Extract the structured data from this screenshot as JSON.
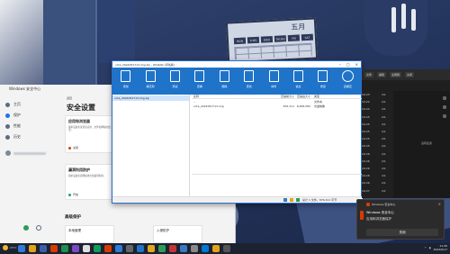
{
  "wallpaper": {
    "calendar_month": "五月",
    "calendar_days": [
      "MON",
      "TUES",
      "WED",
      "THURS",
      "FRI",
      "SAT"
    ]
  },
  "security_app": {
    "app_title": "Windows 安全中心",
    "nav": [
      {
        "label": "主页",
        "icon": "home-icon"
      },
      {
        "label": "保护",
        "icon": "shield-icon"
      },
      {
        "label": "性能",
        "icon": "heart-icon"
      },
      {
        "label": "历史",
        "icon": "history-icon"
      },
      {
        "label": "设置",
        "icon": "gear-icon"
      }
    ],
    "back_label": "返回",
    "page_title": "安全设置",
    "cards": [
      {
        "title": "应用和浏览器",
        "desc": "保护设备免受恶意应用、文件和网站的侵害。",
        "status": "关闭"
      },
      {
        "title": "漏洞利用防护",
        "desc": "保护设备免受网络攻击和漏洞利用。",
        "status": "开启"
      }
    ],
    "section_heading": "高级保护",
    "mini_cards": [
      "本地管理",
      "入侵防护"
    ]
  },
  "explorer": {
    "title": "vcta_2024051713.img.zip - WinRAR (评估版)",
    "toolbar": [
      {
        "label": "添加",
        "icon": "add-archive-icon"
      },
      {
        "label": "解压到",
        "icon": "extract-icon"
      },
      {
        "label": "测试",
        "icon": "test-icon"
      },
      {
        "label": "查看",
        "icon": "view-icon"
      },
      {
        "label": "删除",
        "icon": "delete-icon"
      },
      {
        "label": "查找",
        "icon": "find-icon"
      },
      {
        "label": "向导",
        "icon": "wizard-icon"
      },
      {
        "label": "信息",
        "icon": "info-icon"
      },
      {
        "label": "修复",
        "icon": "repair-icon"
      },
      {
        "label": "自解压",
        "icon": "sfx-icon"
      }
    ],
    "tree_item": "vcta_2024051713.img.zip",
    "columns": [
      "名称",
      "压缩前大小",
      "压缩后大小",
      "类型"
    ],
    "rows": [
      {
        "name": "..",
        "size": "",
        "packed": "",
        "type": "文件夹"
      },
      {
        "name": "vcta_2024051713.img",
        "size": "876,311",
        "packed": "8,658,582",
        "type": "光盘映像"
      }
    ],
    "status_text": "总计 1 文件，876,311 字节"
  },
  "terminal": {
    "buttons": [
      "文件",
      "编辑",
      "全屏幕",
      "关闭"
    ],
    "rows": [
      {
        "time": "19:23",
        "val": "2/1"
      },
      {
        "time": "19:24",
        "val": "2/1"
      },
      {
        "time": "19:24",
        "val": "2/1"
      },
      {
        "time": "19:25",
        "val": "2/1"
      },
      {
        "time": "19:25",
        "val": "2/1"
      },
      {
        "time": "19:25",
        "val": "2/1"
      },
      {
        "time": "19:25",
        "val": "2/1"
      },
      {
        "time": "19:25",
        "val": "2/1"
      },
      {
        "time": "19:26",
        "val": "2/1"
      },
      {
        "time": "19:26",
        "val": "2/1"
      },
      {
        "time": "19:26",
        "val": "2/1"
      },
      {
        "time": "19:26",
        "val": "2/1"
      },
      {
        "time": "19:26",
        "val": "2/1"
      },
      {
        "time": "19:27",
        "val": "2/1"
      }
    ],
    "side_label": "没有任务"
  },
  "toast": {
    "app_name": "Windows 安全中心",
    "title": "Windows 安全中心",
    "body": "应用和浏览器保护",
    "button": "关闭"
  },
  "taskbar": {
    "weather": "23°C",
    "time": "11:45",
    "date": "2024/5/17",
    "apps": [
      "#2f7bd8",
      "#e2a21b",
      "#3b5ea8",
      "#d83b01",
      "#1e8f4f",
      "#7a4bc2",
      "#e0e0e0",
      "#0f9d58",
      "#d83b01",
      "#2f7bd8",
      "#666666",
      "#1f73c9",
      "#e0a81c",
      "#2c9c5b",
      "#c23636",
      "#3b78c4",
      "#8a8a8a",
      "#0078d4",
      "#e2a21b",
      "#555555"
    ]
  },
  "colors": {
    "ribbon_blue": "#1f73c9",
    "accent": "#1a73e8",
    "taskbar": "#1c2230"
  }
}
